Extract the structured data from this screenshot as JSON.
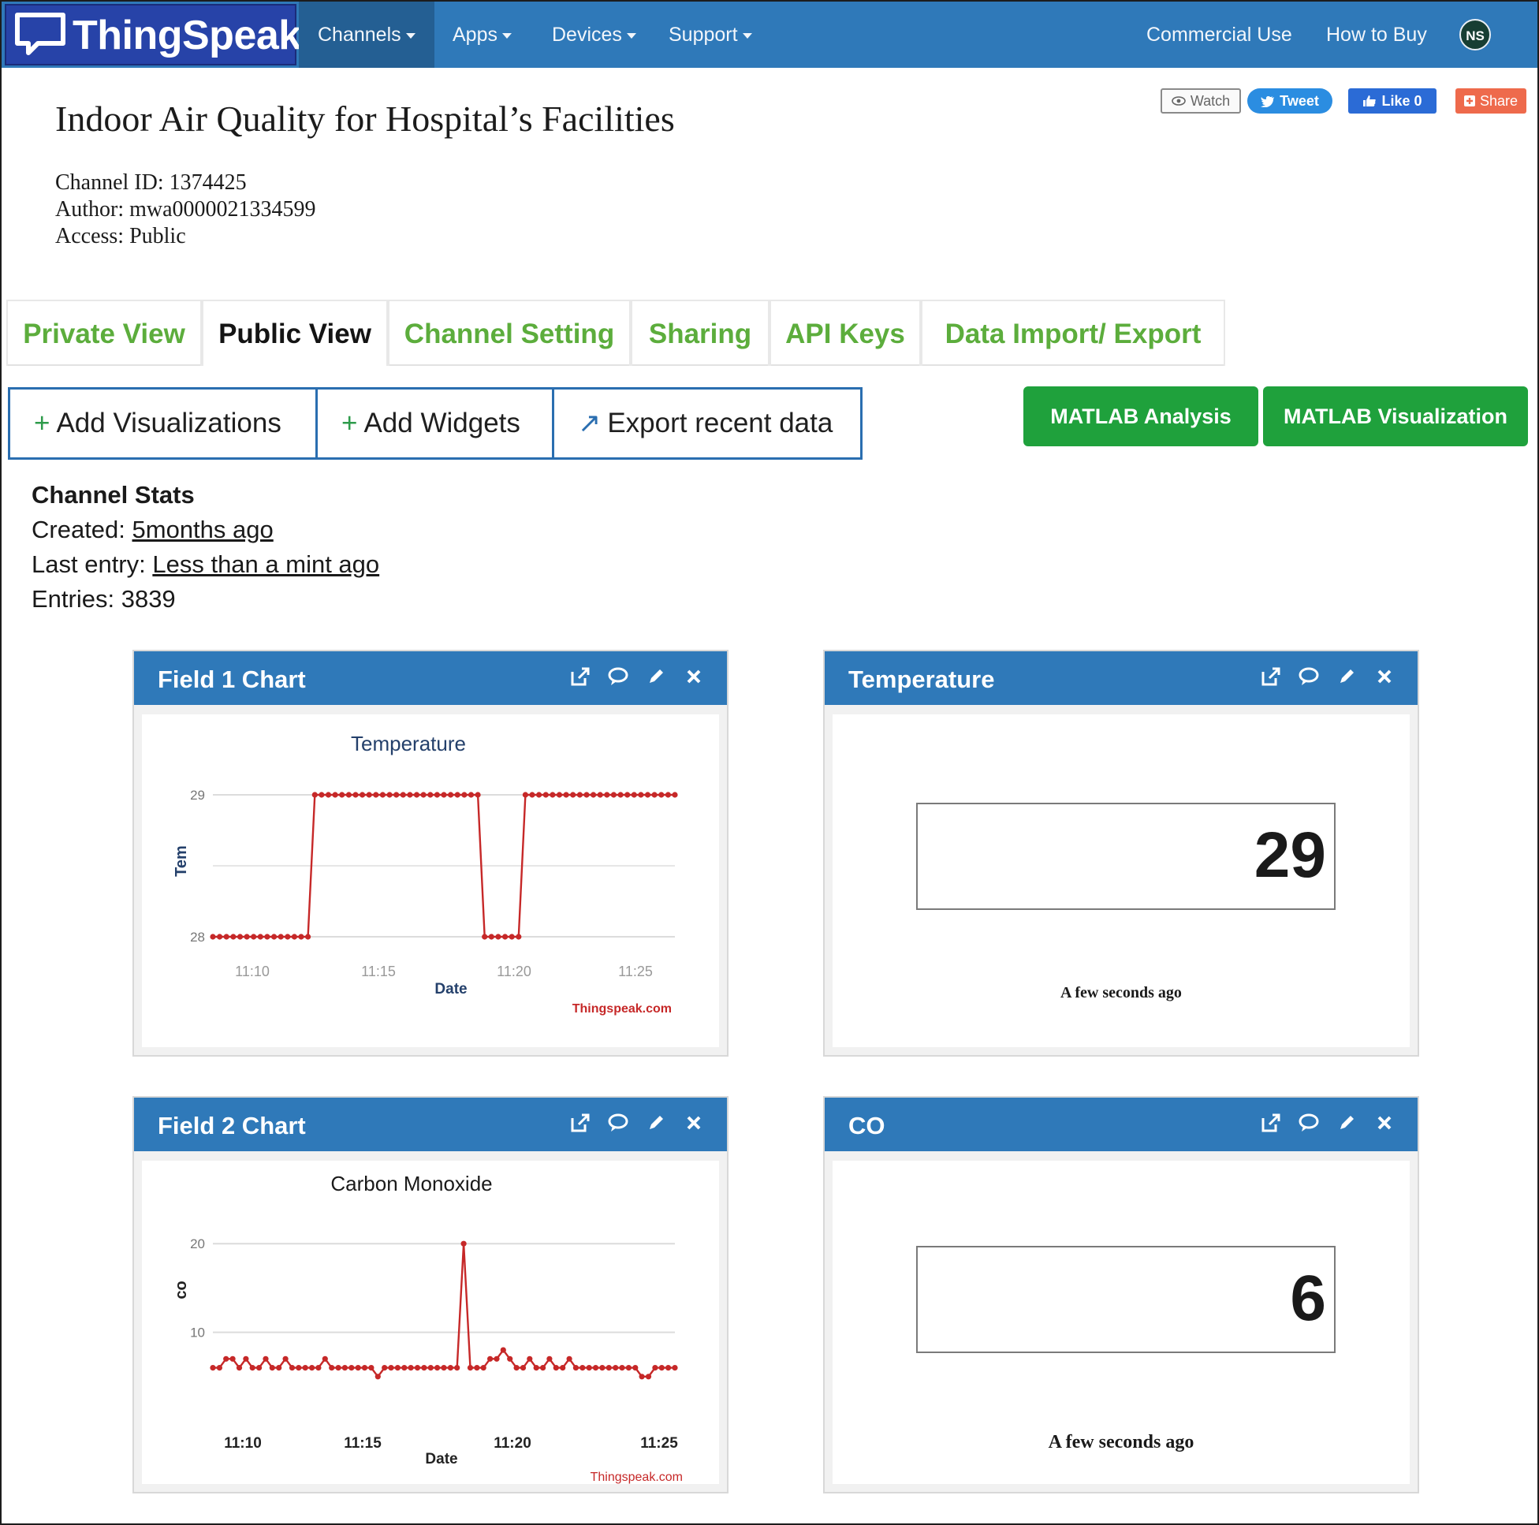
{
  "navbar": {
    "brand": "ThingSpeak",
    "menus": [
      {
        "label": "Channels"
      },
      {
        "label": "Apps"
      },
      {
        "label": "Devices"
      },
      {
        "label": "Support"
      }
    ],
    "links": {
      "commercial": "Commercial Use",
      "how_to_buy": "How to Buy"
    },
    "avatar_initials": "NS",
    "colors": {
      "bar": "#2f79b9",
      "brand_box": "#2743a8"
    }
  },
  "header": {
    "title": "Indoor Air Quality for Hospital’s Facilities",
    "channel_id": "Channel ID: 1374425",
    "author": "Author: mwa0000021334599",
    "access": "Access: Public"
  },
  "social": {
    "watch": "Watch",
    "tweet": "Tweet",
    "like": "Like 0",
    "share": "Share"
  },
  "tabs": [
    {
      "label": "Private View",
      "active": false
    },
    {
      "label": "Public View",
      "active": true
    },
    {
      "label": "Channel Setting",
      "active": false
    },
    {
      "label": "Sharing",
      "active": false
    },
    {
      "label": "API Keys",
      "active": false
    },
    {
      "label": "Data Import/ Export",
      "active": false
    }
  ],
  "actions": {
    "add_visualizations": "Add Visualizations",
    "add_widgets": "Add Widgets",
    "export_recent": "Export recent data",
    "matlab_analysis": "MATLAB Analysis",
    "matlab_visualization": "MATLAB Visualization"
  },
  "stats": {
    "heading": "Channel Stats",
    "created_label": "Created: ",
    "created_value": "5months ago",
    "last_entry_label": "Last entry: ",
    "last_entry_value": "Less than a mint ago",
    "entries": "Entries: 3839"
  },
  "widgets": {
    "field1": {
      "title": "Field 1 Chart"
    },
    "temperature": {
      "title": "Temperature",
      "value": "29",
      "updated": "A few seconds ago"
    },
    "field2": {
      "title": "Field 2 Chart"
    },
    "co": {
      "title": "CO",
      "value": "6",
      "updated": "A few seconds ago"
    }
  },
  "chart_data": [
    {
      "type": "line",
      "title": "Temperature",
      "xlabel": "Date",
      "ylabel": "Tem",
      "x_ticks": [
        "11:10",
        "11:15",
        "11:20",
        "11:25"
      ],
      "y_ticks": [
        28,
        29
      ],
      "ylim": [
        28,
        29
      ],
      "credit": "Thingspeak.com",
      "series_color": "#c62828",
      "series": [
        {
          "values": [
            28,
            28,
            28,
            28,
            28,
            28,
            28,
            28,
            28,
            28,
            28,
            28,
            28,
            28,
            28,
            29,
            29,
            29,
            29,
            29,
            29,
            29,
            29,
            29,
            29,
            29,
            29,
            29,
            29,
            29,
            29,
            29,
            29,
            29,
            29,
            29,
            29,
            29,
            29,
            29,
            28,
            28,
            28,
            28,
            28,
            28,
            29,
            29,
            29,
            29,
            29,
            29,
            29,
            29,
            29,
            29,
            29,
            29,
            29,
            29,
            29,
            29,
            29,
            29,
            29,
            29,
            29,
            29,
            29
          ]
        }
      ]
    },
    {
      "type": "line",
      "title": "Carbon Monoxide",
      "xlabel": "Date",
      "ylabel": "co",
      "x_ticks": [
        "11:10",
        "11:15",
        "11:20",
        "11:25"
      ],
      "y_ticks": [
        10,
        20
      ],
      "ylim": [
        0,
        21
      ],
      "credit": "Thingspeak.com",
      "series_color": "#c62828",
      "series": [
        {
          "values": [
            6,
            6,
            7,
            7,
            6,
            7,
            6,
            6,
            7,
            6,
            6,
            7,
            6,
            6,
            6,
            6,
            6,
            7,
            6,
            6,
            6,
            6,
            6,
            6,
            6,
            5,
            6,
            6,
            6,
            6,
            6,
            6,
            6,
            6,
            6,
            6,
            6,
            6,
            20,
            6,
            6,
            6,
            7,
            7,
            8,
            7,
            6,
            6,
            7,
            6,
            6,
            7,
            6,
            6,
            7,
            6,
            6,
            6,
            6,
            6,
            6,
            6,
            6,
            6,
            6,
            5,
            5,
            6,
            6,
            6,
            6
          ]
        }
      ]
    }
  ]
}
